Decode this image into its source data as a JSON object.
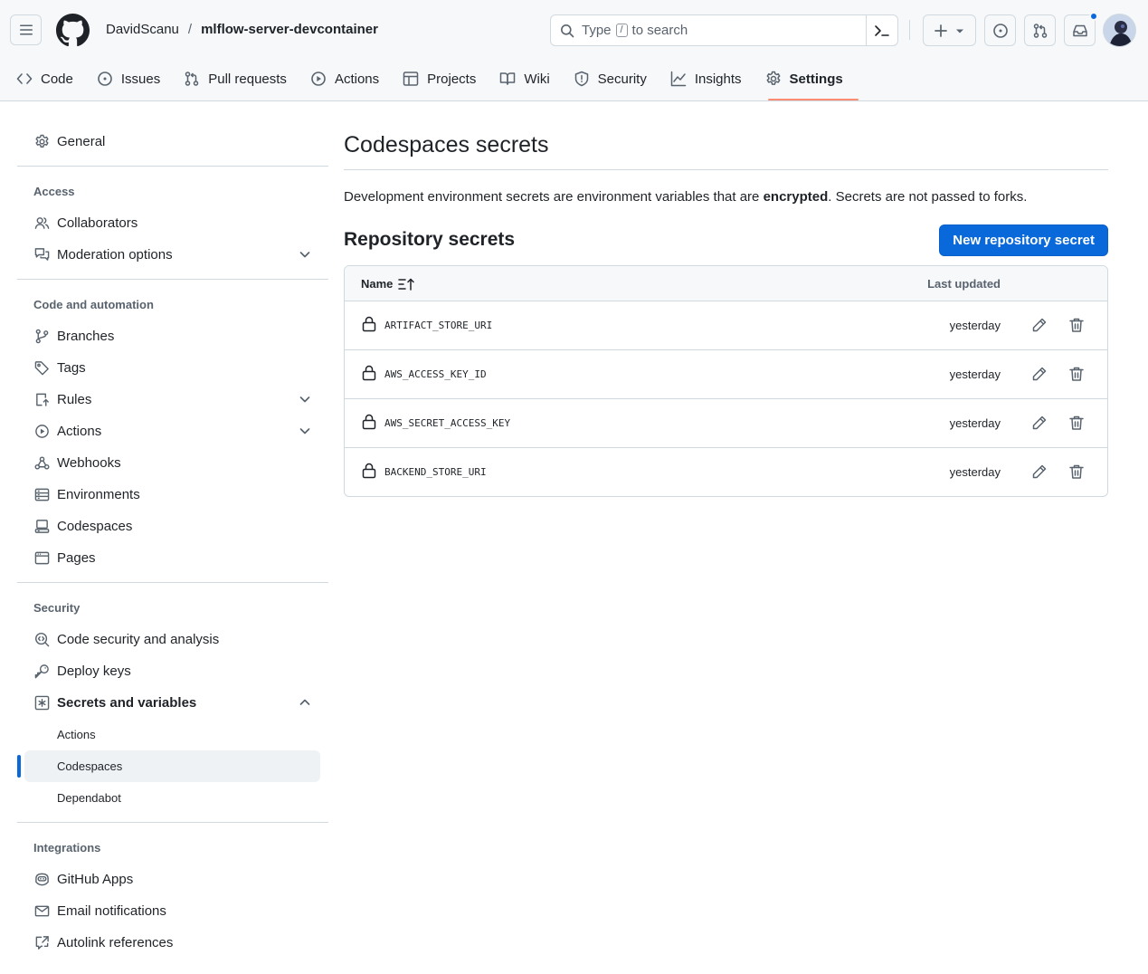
{
  "header": {
    "owner": "DavidScanu",
    "separator": "/",
    "repo": "mlflow-server-devcontainer",
    "search_prefix": "Type",
    "search_key": "/",
    "search_suffix": "to search"
  },
  "tabs": [
    {
      "label": "Code",
      "icon": "code-icon"
    },
    {
      "label": "Issues",
      "icon": "issue-icon"
    },
    {
      "label": "Pull requests",
      "icon": "pull-request-icon"
    },
    {
      "label": "Actions",
      "icon": "play-icon"
    },
    {
      "label": "Projects",
      "icon": "table-icon"
    },
    {
      "label": "Wiki",
      "icon": "book-icon"
    },
    {
      "label": "Security",
      "icon": "shield-icon"
    },
    {
      "label": "Insights",
      "icon": "graph-icon"
    },
    {
      "label": "Settings",
      "icon": "gear-icon",
      "selected": true
    }
  ],
  "sidebar": {
    "general": "General",
    "access": {
      "title": "Access",
      "collaborators": "Collaborators",
      "moderation": "Moderation options"
    },
    "code_automation": {
      "title": "Code and automation",
      "branches": "Branches",
      "tags": "Tags",
      "rules": "Rules",
      "actions": "Actions",
      "webhooks": "Webhooks",
      "environments": "Environments",
      "codespaces": "Codespaces",
      "pages": "Pages"
    },
    "security": {
      "title": "Security",
      "code_security": "Code security and analysis",
      "deploy_keys": "Deploy keys",
      "secrets": "Secrets and variables",
      "sub_actions": "Actions",
      "sub_codespaces": "Codespaces",
      "sub_dependabot": "Dependabot"
    },
    "integrations": {
      "title": "Integrations",
      "github_apps": "GitHub Apps",
      "email": "Email notifications",
      "autolink": "Autolink references"
    }
  },
  "main": {
    "title": "Codespaces secrets",
    "desc_before": "Development environment secrets are environment variables that are ",
    "desc_bold": "encrypted",
    "desc_after": ". Secrets are not passed to forks.",
    "section_title": "Repository secrets",
    "new_button": "New repository secret",
    "col_name": "Name",
    "col_updated": "Last updated",
    "secrets": [
      {
        "name": "ARTIFACT_STORE_URI",
        "updated": "yesterday"
      },
      {
        "name": "AWS_ACCESS_KEY_ID",
        "updated": "yesterday"
      },
      {
        "name": "AWS_SECRET_ACCESS_KEY",
        "updated": "yesterday"
      },
      {
        "name": "BACKEND_STORE_URI",
        "updated": "yesterday"
      }
    ]
  },
  "colors": {
    "accent": "#0969da",
    "tab_underline": "#fd8c73",
    "border": "#d1d9e0",
    "muted": "#59636e"
  }
}
